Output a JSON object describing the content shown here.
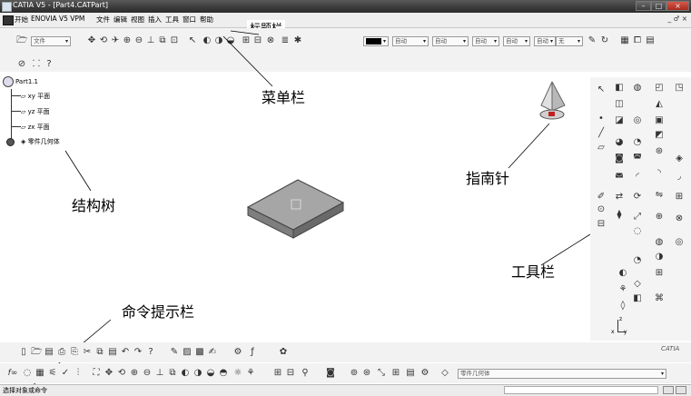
{
  "window": {
    "title": "CATIA V5 - [Part4.CATPart]",
    "controls": [
      "–",
      "□",
      "×"
    ]
  },
  "menu": {
    "items": [
      "开始",
      "ENOVIA V5 VPM",
      "文件",
      "编辑",
      "视图",
      "插入",
      "工具",
      "窗口",
      "帮助"
    ],
    "right_controls": "_ ♂ ×"
  },
  "toolbar_top": {
    "file_dropdown": "文件",
    "color_dropdown": "",
    "line_dropdowns": [
      "自动",
      "自动",
      "自动",
      "自动",
      "自动",
      "无"
    ]
  },
  "tree": {
    "root": "Part1.1",
    "items": [
      "xy 平面",
      "yz 平面",
      "zx 平面",
      "零件几何体"
    ]
  },
  "annotations": {
    "title_bar": "标题栏",
    "menu_bar": "菜单栏",
    "spec_tree": "结构树",
    "compass": "指南针",
    "toolbar": "工具栏",
    "command_prompt": "命令提示栏"
  },
  "axis": {
    "z": "z",
    "x": "x",
    "y": "y"
  },
  "bottom_toolbar": {
    "part_body_dropdown": "零件几何体",
    "catia_logo": "CATIA"
  },
  "status": {
    "text": "选择对象或命令"
  },
  "colors": {
    "titlebar": "#3a3a3a",
    "toolbar_bg": "#f2f2f2",
    "solid_face": "#9a9a9a",
    "annotation": "#000000"
  }
}
